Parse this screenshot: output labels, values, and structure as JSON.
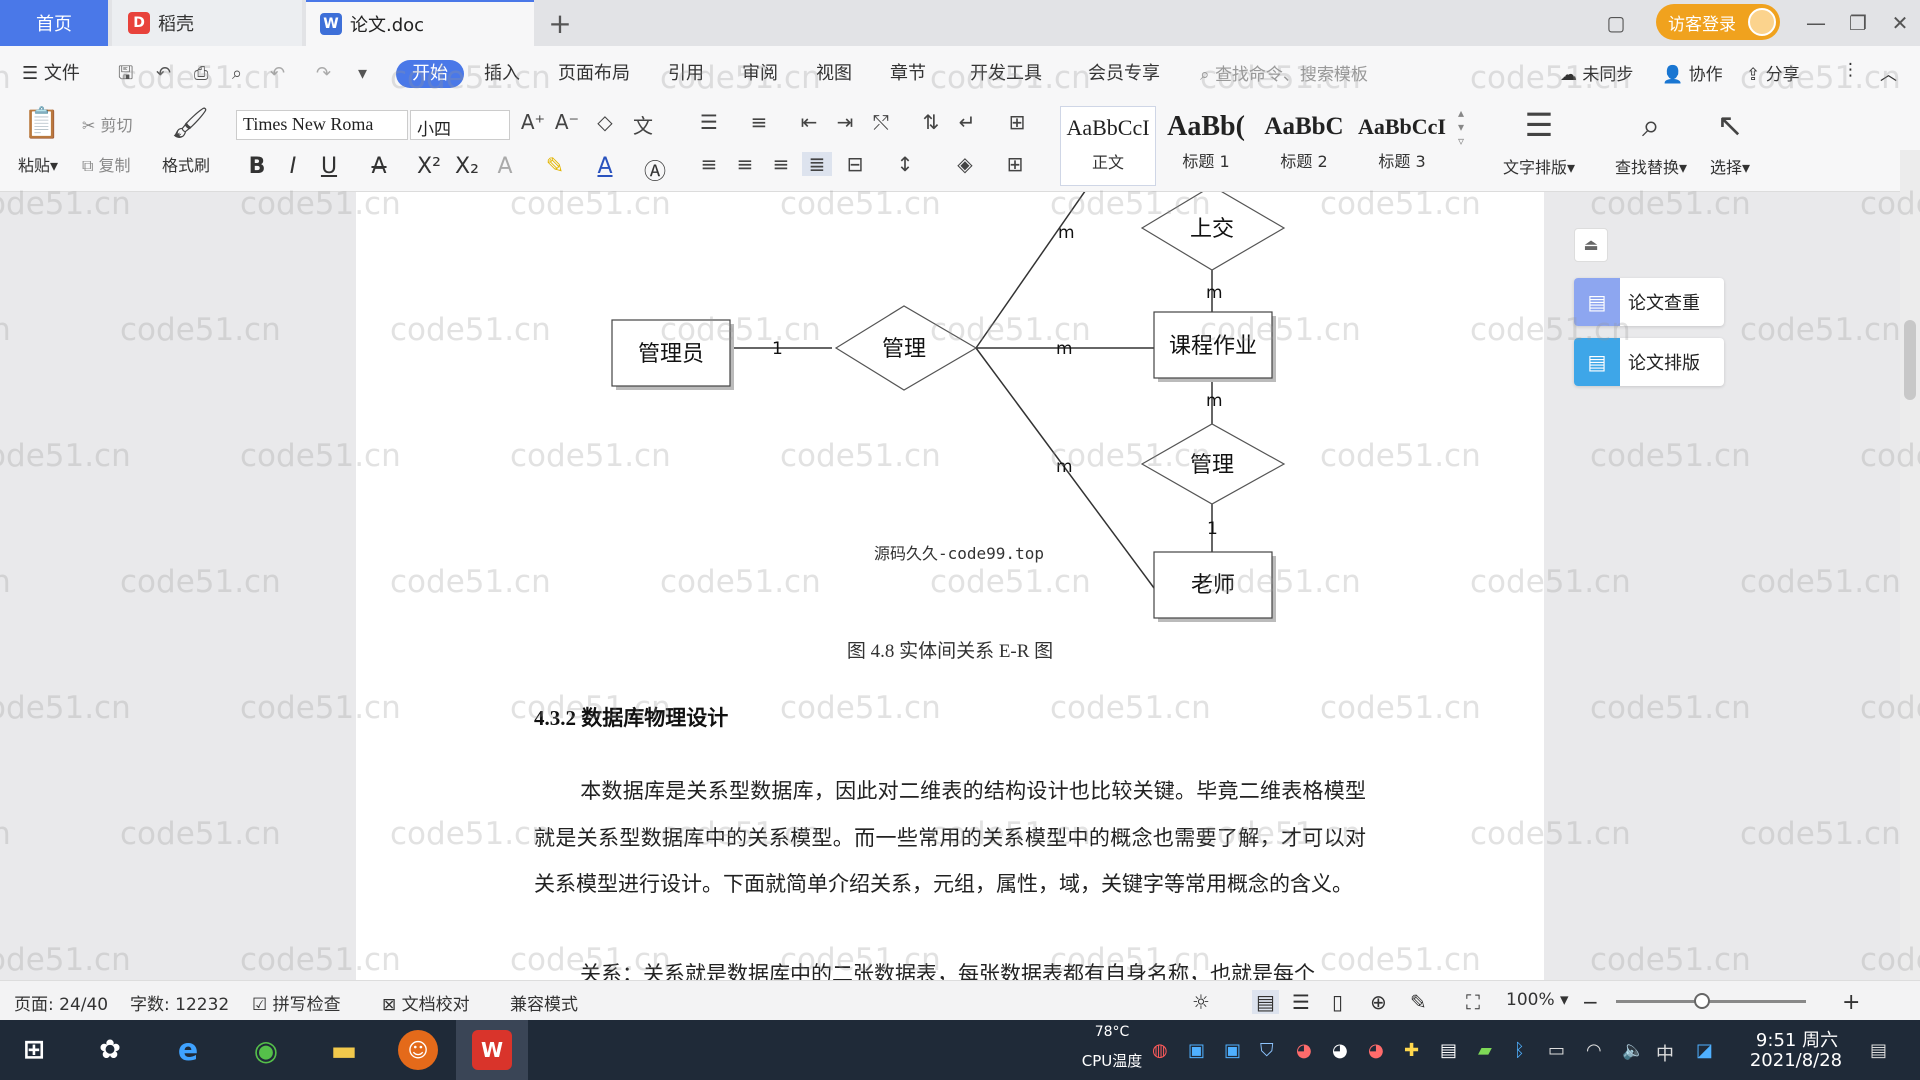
{
  "tabs": {
    "home": "首页",
    "daoke": "稻壳",
    "doc": "论文.doc",
    "add": "+"
  },
  "window": {
    "login": "访客登录"
  },
  "menu": {
    "file": "文件",
    "items": [
      "开始",
      "插入",
      "页面布局",
      "引用",
      "审阅",
      "视图",
      "章节",
      "开发工具",
      "会员专享"
    ],
    "search_placeholder": "查找命令、搜索模板",
    "unsynced": "未同步",
    "collab": "协作",
    "share": "分享"
  },
  "ribbon": {
    "paste": "粘贴",
    "cut": "剪切",
    "copy": "复制",
    "format_painter": "格式刷",
    "font_name": "Times New Roma",
    "font_size": "小四",
    "styles": [
      {
        "sample": "AaBbCcI",
        "name": "正文"
      },
      {
        "sample": "AaBb(",
        "name": "标题 1"
      },
      {
        "sample": "AaBbC",
        "name": "标题 2"
      },
      {
        "sample": "AaBbCcI",
        "name": "标题 3"
      }
    ],
    "text_layout": "文字排版",
    "find_replace": "查找替换",
    "select": "选择"
  },
  "diagram": {
    "entities": {
      "admin": "管理员",
      "coursework": "课程作业",
      "teacher": "老师"
    },
    "relations": {
      "manage_left": "管理",
      "submit": "上交",
      "manage_right": "管理"
    },
    "cardinalities": {
      "admin_manage": "1",
      "manage_up": "m",
      "manage_coursework": "m",
      "manage_down": "m",
      "submit_coursework": "m",
      "coursework_manage": "m",
      "manage_teacher": "1"
    },
    "watermark_text": "源码久久-code99.top"
  },
  "document": {
    "caption": "图 4.8  实体间关系 E-R 图",
    "heading": "4.3.2  数据库物理设计",
    "paragraph": "本数据库是关系型数据库，因此对二维表的结构设计也比较关键。毕竟二维表格模型就是关系型数据库中的关系模型。而一些常用的关系模型中的概念也需要了解，才可以对关系模型进行设计。下面就简单介绍关系，元组，属性，域，关键字等常用概念的含义。",
    "partial_line": "关系：关系就是数据库中的二张数据表，每张数据表都有自身名称，也就是每个"
  },
  "side_panel": {
    "check": "论文查重",
    "layout": "论文排版"
  },
  "status": {
    "page": "页面: 24/40",
    "words": "字数: 12232",
    "spell": "拼写检查",
    "proof": "文档校对",
    "compat": "兼容模式",
    "zoom": "100%",
    "zoom_level": 0.45
  },
  "taskbar": {
    "cpu_temp": "78°C",
    "cpu_label": "CPU温度",
    "ime": "中",
    "time": "9:51 周六",
    "date": "2021/8/28"
  },
  "watermark": "code51.cn",
  "colors": {
    "accent": "#4a78e8",
    "login": "#f0a21e",
    "taskbar": "#1f2a38"
  }
}
